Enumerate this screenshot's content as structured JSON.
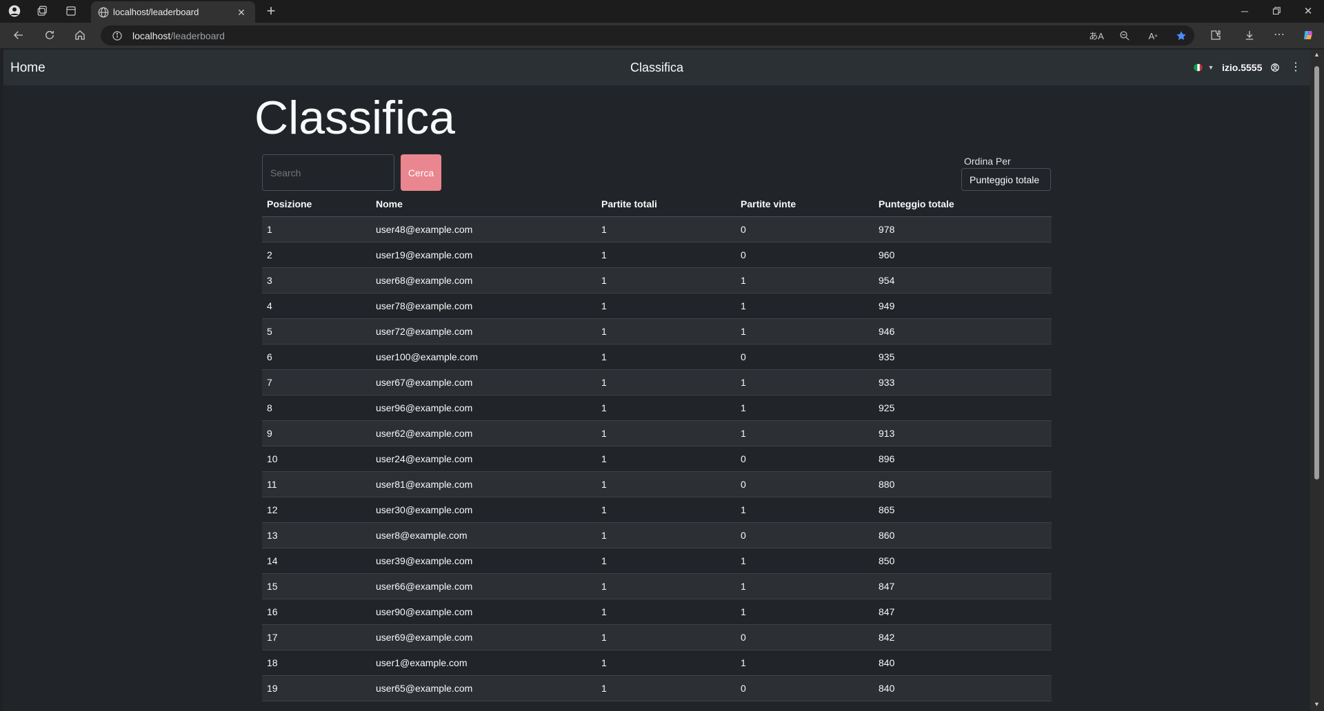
{
  "browser": {
    "tab_title": "localhost/leaderboard",
    "url_host": "localhost",
    "url_path": "/leaderboard"
  },
  "navbar": {
    "home_label": "Home",
    "title": "Classifica",
    "username": "izio.5555"
  },
  "page": {
    "heading": "Classifica",
    "search_placeholder": "Search",
    "search_button": "Cerca",
    "sort_label": "Ordina Per",
    "sort_value": "Punteggio totale"
  },
  "table": {
    "headers": [
      "Posizione",
      "Nome",
      "Partite totali",
      "Partite vinte",
      "Punteggio totale"
    ],
    "rows": [
      [
        "1",
        "user48@example.com",
        "1",
        "0",
        "978"
      ],
      [
        "2",
        "user19@example.com",
        "1",
        "0",
        "960"
      ],
      [
        "3",
        "user68@example.com",
        "1",
        "1",
        "954"
      ],
      [
        "4",
        "user78@example.com",
        "1",
        "1",
        "949"
      ],
      [
        "5",
        "user72@example.com",
        "1",
        "1",
        "946"
      ],
      [
        "6",
        "user100@example.com",
        "1",
        "0",
        "935"
      ],
      [
        "7",
        "user67@example.com",
        "1",
        "1",
        "933"
      ],
      [
        "8",
        "user96@example.com",
        "1",
        "1",
        "925"
      ],
      [
        "9",
        "user62@example.com",
        "1",
        "1",
        "913"
      ],
      [
        "10",
        "user24@example.com",
        "1",
        "0",
        "896"
      ],
      [
        "11",
        "user81@example.com",
        "1",
        "0",
        "880"
      ],
      [
        "12",
        "user30@example.com",
        "1",
        "1",
        "865"
      ],
      [
        "13",
        "user8@example.com",
        "1",
        "0",
        "860"
      ],
      [
        "14",
        "user39@example.com",
        "1",
        "1",
        "850"
      ],
      [
        "15",
        "user66@example.com",
        "1",
        "1",
        "847"
      ],
      [
        "16",
        "user90@example.com",
        "1",
        "1",
        "847"
      ],
      [
        "17",
        "user69@example.com",
        "1",
        "0",
        "842"
      ],
      [
        "18",
        "user1@example.com",
        "1",
        "1",
        "840"
      ],
      [
        "19",
        "user65@example.com",
        "1",
        "0",
        "840"
      ]
    ]
  },
  "colors": {
    "accent_button": "#ea868f",
    "page_bg": "#212529",
    "navbar_bg": "#2b3035"
  }
}
